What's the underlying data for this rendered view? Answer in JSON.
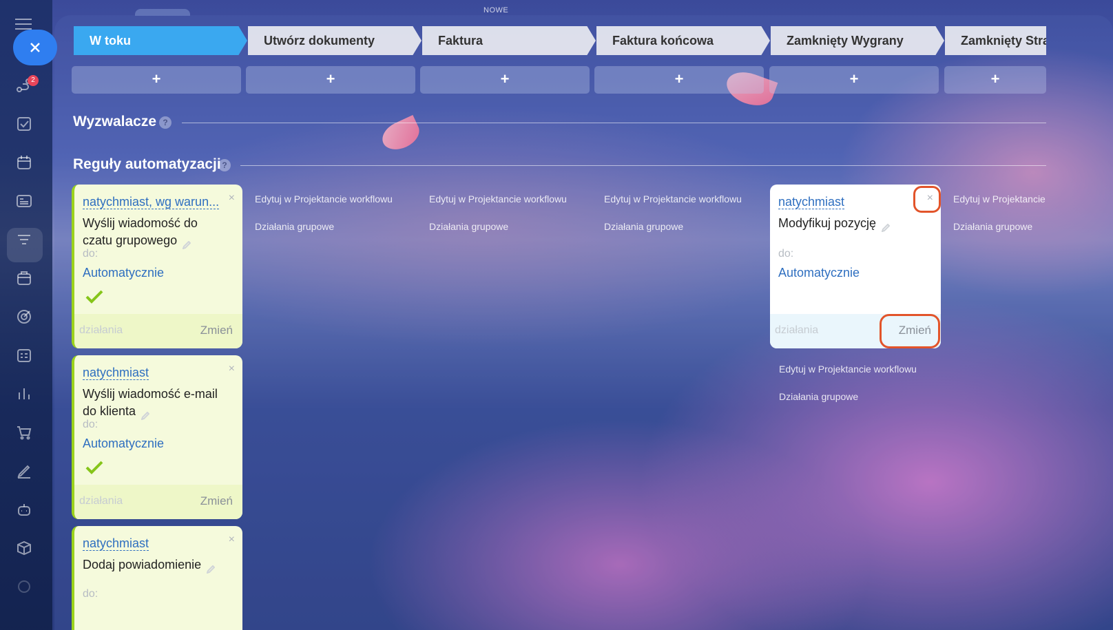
{
  "header": {
    "top_label": "NOWE"
  },
  "rail": {
    "notification_count": "2"
  },
  "stages": [
    {
      "label": "W toku"
    },
    {
      "label": "Utwórz dokumenty"
    },
    {
      "label": "Faktura"
    },
    {
      "label": "Faktura końcowa"
    },
    {
      "label": "Zamknięty Wygrany"
    },
    {
      "label": "Zamknięty Strac"
    }
  ],
  "plus_label": "+",
  "sections": {
    "triggers": "Wyzwalacze",
    "rules": "Reguły automatyzacji",
    "help": "?"
  },
  "columns": {
    "edit_link": "Edytuj w Projektancie workflowu",
    "edit_link_cut": "Edytuj w Projektancie",
    "group_link": "Działania grupowe"
  },
  "cards": [
    {
      "trigger": "natychmiast, wg warun...",
      "title": "Wyślij wiadomość do czatu grupowego",
      "to_label": "do:",
      "assignee": "Automatycznie",
      "footer_left": "działania",
      "footer_right": "Zmień",
      "close": "×"
    },
    {
      "trigger": "natychmiast",
      "title": "Wyślij wiadomość e-mail do klienta",
      "to_label": "do:",
      "assignee": "Automatycznie",
      "footer_left": "działania",
      "footer_right": "Zmień",
      "close": "×"
    },
    {
      "trigger": "natychmiast",
      "title": "Dodaj powiadomienie",
      "to_label": "do:",
      "close": "×"
    },
    {
      "trigger": "natychmiast",
      "title": "Modyfikuj pozycję",
      "to_label": "do:",
      "assignee": "Automatycznie",
      "footer_left": "działania",
      "footer_right": "Zmień",
      "close": "×"
    }
  ],
  "colors": {
    "accent": "#3aa8f0",
    "link": "#2f6fc0",
    "highlight": "#e2542a",
    "check": "#86c51a"
  }
}
